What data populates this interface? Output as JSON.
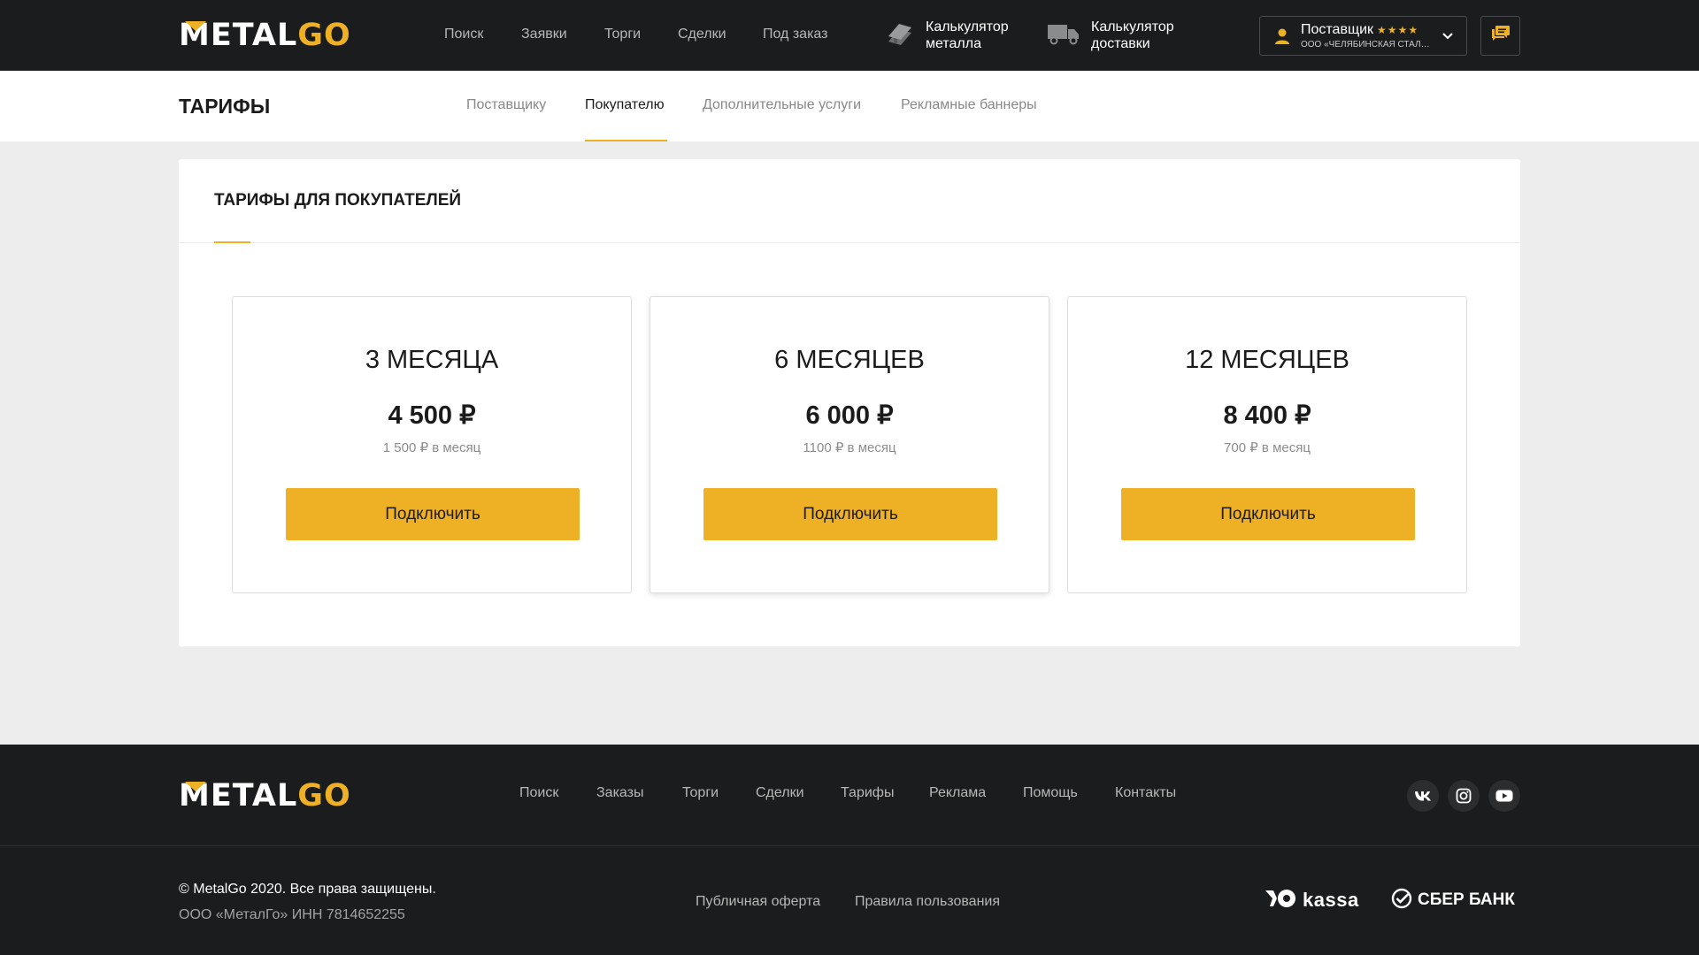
{
  "header": {
    "logo": {
      "part1": "METAL",
      "part2": "GO"
    },
    "nav": [
      "Поиск",
      "Заявки",
      "Торги",
      "Сделки",
      "Под заказ"
    ],
    "calculators": [
      {
        "line1": "Калькулятор",
        "line2": "металла",
        "icon": "metal-beam-icon"
      },
      {
        "line1": "Калькулятор",
        "line2": "доставки",
        "icon": "truck-icon"
      }
    ],
    "user": {
      "role": "Поставщик",
      "stars": "★★★★",
      "company": "ООО «ЧЕЛЯБИНСКАЯ СТАЛЬН..."
    },
    "messages_icon": "chat-icon"
  },
  "subheader": {
    "title": "ТАРИФЫ",
    "tabs": [
      "Поставщику",
      "Покупателю",
      "Дополнительные услуги",
      "Рекламные баннеры"
    ],
    "active_tab": "Покупателю"
  },
  "panel": {
    "title": "ТАРИФЫ ДЛЯ ПОКУПАТЕЛЕЙ",
    "cards": [
      {
        "period": "3 МЕСЯЦА",
        "price": "4 500 ₽",
        "monthly": "1 500 ₽ в месяц",
        "button": "Подключить"
      },
      {
        "period": "6 МЕСЯЦЕВ",
        "price": "6 000 ₽",
        "monthly": "1100 ₽ в месяц",
        "button": "Подключить"
      },
      {
        "period": "12 МЕСЯЦЕВ",
        "price": "8 400 ₽",
        "monthly": "700 ₽ в месяц",
        "button": "Подключить"
      }
    ]
  },
  "footer": {
    "logo": {
      "part1": "METAL",
      "part2": "GO"
    },
    "links": [
      "Поиск",
      "Заказы",
      "Торги",
      "Сделки",
      "Тарифы",
      "Реклама",
      "Помощь",
      "Контакты"
    ],
    "social": [
      "vk-icon",
      "instagram-icon",
      "youtube-icon"
    ],
    "copyright": "© MetalGo 2020. Все права защищены.",
    "company": "ООО «МеталГо» ИНН 7814652255",
    "legal_links": [
      "Публичная оферта",
      "Правила пользования"
    ],
    "payments": {
      "kassa": "kassa",
      "sber": "СБЕР БАНК"
    }
  },
  "colors": {
    "accent": "#eeb024",
    "dark": "#1b1c1d",
    "background": "#ededed"
  }
}
